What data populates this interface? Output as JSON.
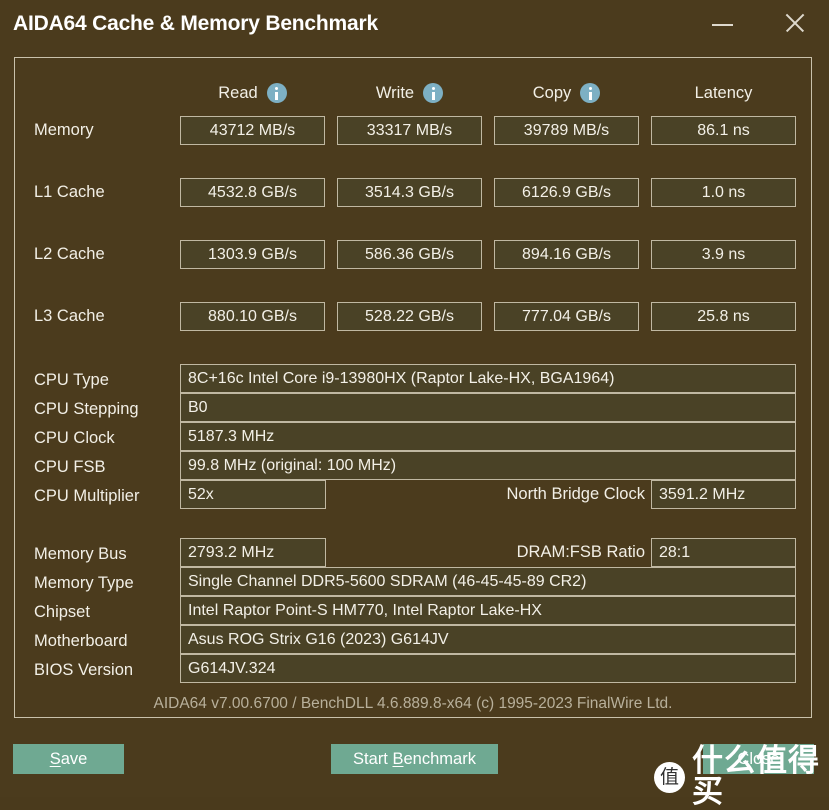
{
  "window": {
    "title": "AIDA64 Cache & Memory Benchmark",
    "minimize_label": "minimize",
    "close_label": "close"
  },
  "benchmark": {
    "columns": [
      {
        "label": "Read",
        "has_info": true
      },
      {
        "label": "Write",
        "has_info": true
      },
      {
        "label": "Copy",
        "has_info": true
      },
      {
        "label": "Latency",
        "has_info": false
      }
    ],
    "rows": [
      {
        "label": "Memory",
        "read": "43712 MB/s",
        "write": "33317 MB/s",
        "copy": "39789 MB/s",
        "latency": "86.1 ns"
      },
      {
        "label": "L1 Cache",
        "read": "4532.8 GB/s",
        "write": "3514.3 GB/s",
        "copy": "6126.9 GB/s",
        "latency": "1.0 ns"
      },
      {
        "label": "L2 Cache",
        "read": "1303.9 GB/s",
        "write": "586.36 GB/s",
        "copy": "894.16 GB/s",
        "latency": "3.9 ns"
      },
      {
        "label": "L3 Cache",
        "read": "880.10 GB/s",
        "write": "528.22 GB/s",
        "copy": "777.04 GB/s",
        "latency": "25.8 ns"
      }
    ]
  },
  "cpu_info": {
    "cpu_type_label": "CPU Type",
    "cpu_type_value": "8C+16c Intel Core i9-13980HX  (Raptor Lake-HX, BGA1964)",
    "cpu_stepping_label": "CPU Stepping",
    "cpu_stepping_value": "B0",
    "cpu_clock_label": "CPU Clock",
    "cpu_clock_value": "5187.3 MHz",
    "cpu_fsb_label": "CPU FSB",
    "cpu_fsb_value": "99.8 MHz  (original: 100 MHz)",
    "cpu_multiplier_label": "CPU Multiplier",
    "cpu_multiplier_value": "52x",
    "north_bridge_clock_label": "North Bridge Clock",
    "north_bridge_clock_value": "3591.2 MHz"
  },
  "system_info": {
    "memory_bus_label": "Memory Bus",
    "memory_bus_value": "2793.2 MHz",
    "dram_fsb_ratio_label": "DRAM:FSB Ratio",
    "dram_fsb_ratio_value": "28:1",
    "memory_type_label": "Memory Type",
    "memory_type_value": "Single Channel DDR5-5600 SDRAM  (46-45-45-89 CR2)",
    "chipset_label": "Chipset",
    "chipset_value": "Intel Raptor Point-S HM770, Intel Raptor Lake-HX",
    "motherboard_label": "Motherboard",
    "motherboard_value": "Asus ROG Strix G16 (2023) G614JV",
    "bios_version_label": "BIOS Version",
    "bios_version_value": "G614JV.324"
  },
  "footer": {
    "version_text": "AIDA64 v7.00.6700 / BenchDLL 4.6.889.8-x64  (c) 1995-2023 FinalWire Ltd.",
    "save_label_pre": "",
    "save_accel": "S",
    "save_label_post": "ave",
    "bench_label_pre": "Start ",
    "bench_accel": "B",
    "bench_label_post": "enchmark",
    "close_label": "Close"
  },
  "watermark": {
    "badge_char": "值",
    "text": "什么值得买"
  },
  "colors": {
    "background": "#4b3b1d",
    "panel_border": "#c9c1ab",
    "field_fill": "#4a4226",
    "field_border": "#c0b8a2",
    "text": "#f2efe6",
    "muted_text": "#b8b09b",
    "button": "#6fa992",
    "info_icon": "#7db0c4"
  }
}
